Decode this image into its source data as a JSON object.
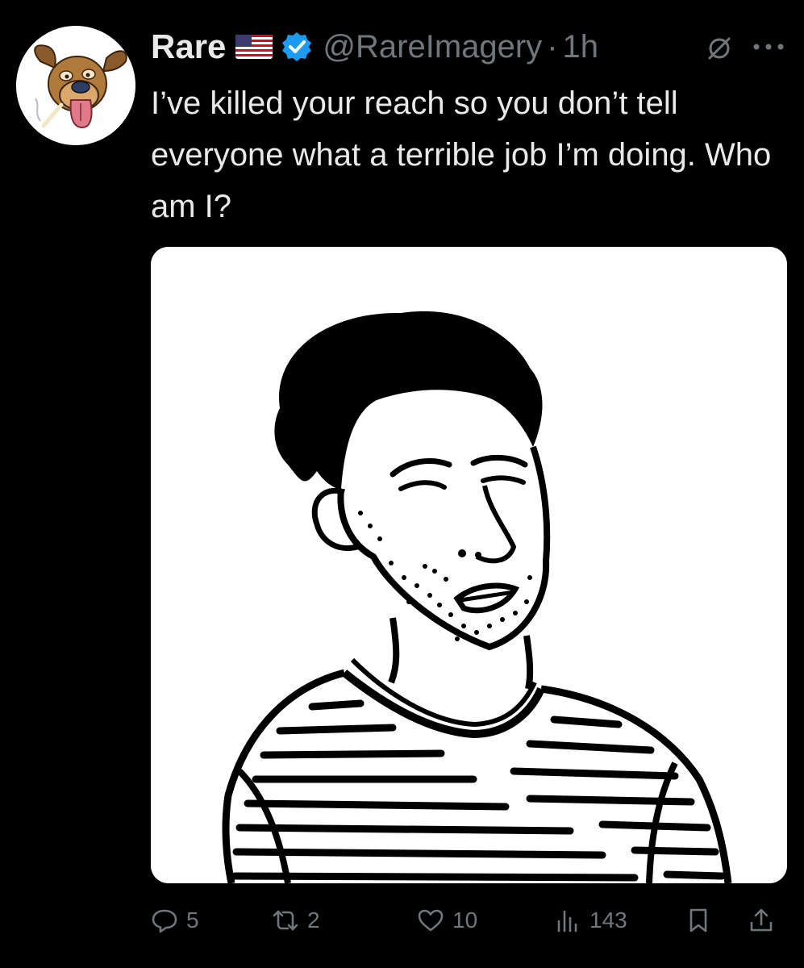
{
  "tweet": {
    "display_name": "Rare",
    "handle": "@RareImagery",
    "separator": "·",
    "time": "1h",
    "text": "I’ve killed your reach so you don’t tell everyone what a terrible job I’m doing. Who am I?",
    "avatar_icon": "cartoon-dog-icon",
    "flag_icon": "us-flag-icon",
    "verified_icon": "verified-badge-icon",
    "media_description": "line-drawing-man-striped-shirt"
  },
  "actions": {
    "replies": "5",
    "reposts": "2",
    "likes": "10",
    "views": "143"
  },
  "colors": {
    "background": "#000000",
    "text": "#e7e9ea",
    "muted": "#71767b",
    "verified": "#1d9bf0"
  }
}
